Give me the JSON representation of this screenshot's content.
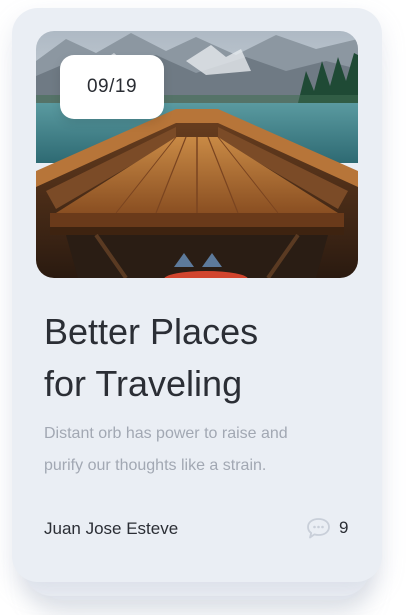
{
  "card": {
    "date": "09/19",
    "title_line1": "Better Places",
    "title_line2": "for Traveling",
    "description_line1": "Distant orb has power to raise and",
    "description_line2": "purify our thoughts like a strain.",
    "author": "Juan Jose Esteve",
    "comment_count": "9",
    "comment_icon": "speech-bubble-icon",
    "colors": {
      "card_background": "#eaeef4",
      "title_text": "#2b2e35",
      "description_text": "#a2a8b3",
      "badge_background": "#ffffff",
      "comment_icon": "#c9cfd9"
    }
  }
}
